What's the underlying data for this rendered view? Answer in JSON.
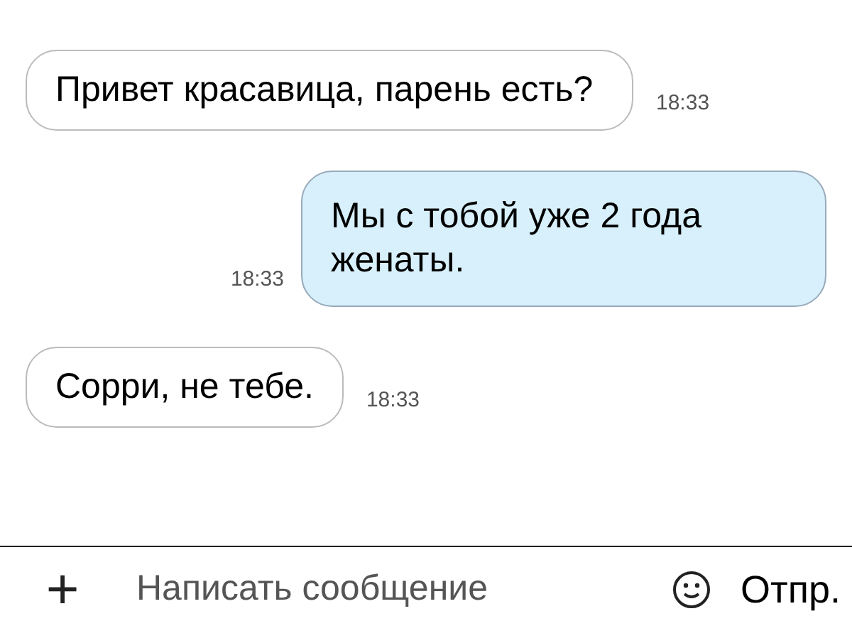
{
  "messages": [
    {
      "kind": "incoming",
      "text": "Привет красавица, парень есть?",
      "time": "18:33"
    },
    {
      "kind": "outgoing",
      "text": "Мы с тобой уже 2 года женаты.",
      "time": "18:33"
    },
    {
      "kind": "incoming",
      "text": "Сорри, не тебе.",
      "time": "18:33"
    }
  ],
  "composer": {
    "attach": "+",
    "placeholder": "Написать сообщение",
    "send": "Отпр."
  }
}
